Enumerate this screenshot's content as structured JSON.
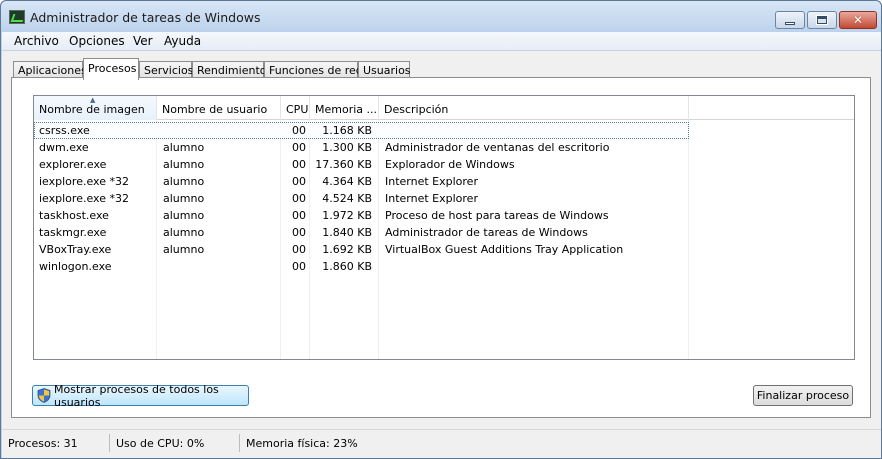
{
  "window": {
    "title": "Administrador de tareas de Windows"
  },
  "menu": [
    "Archivo",
    "Opciones",
    "Ver",
    "Ayuda"
  ],
  "tabs": [
    "Aplicaciones",
    "Procesos",
    "Servicios",
    "Rendimiento",
    "Funciones de red",
    "Usuarios"
  ],
  "active_tab": "Procesos",
  "columns": [
    "Nombre de imagen",
    "Nombre de usuario",
    "CPU",
    "Memoria ...",
    "Descripción"
  ],
  "sorted_column": "Nombre de imagen",
  "processes": [
    {
      "name": "csrss.exe",
      "user": "",
      "cpu": "00",
      "memory": "1.168 KB",
      "description": ""
    },
    {
      "name": "dwm.exe",
      "user": "alumno",
      "cpu": "00",
      "memory": "1.300 KB",
      "description": "Administrador de ventanas del escritorio"
    },
    {
      "name": "explorer.exe",
      "user": "alumno",
      "cpu": "00",
      "memory": "17.360 KB",
      "description": "Explorador de Windows"
    },
    {
      "name": "iexplore.exe *32",
      "user": "alumno",
      "cpu": "00",
      "memory": "4.364 KB",
      "description": "Internet Explorer"
    },
    {
      "name": "iexplore.exe *32",
      "user": "alumno",
      "cpu": "00",
      "memory": "4.524 KB",
      "description": "Internet Explorer"
    },
    {
      "name": "taskhost.exe",
      "user": "alumno",
      "cpu": "00",
      "memory": "1.972 KB",
      "description": "Proceso de host para tareas de Windows"
    },
    {
      "name": "taskmgr.exe",
      "user": "alumno",
      "cpu": "00",
      "memory": "1.840 KB",
      "description": "Administrador de tareas de Windows"
    },
    {
      "name": "VBoxTray.exe",
      "user": "alumno",
      "cpu": "00",
      "memory": "1.692 KB",
      "description": "VirtualBox Guest Additions Tray Application"
    },
    {
      "name": "winlogon.exe",
      "user": "",
      "cpu": "00",
      "memory": "1.860 KB",
      "description": ""
    }
  ],
  "selected_row": 0,
  "buttons": {
    "show_all": "Mostrar procesos de todos los usuarios",
    "end_process": "Finalizar proceso"
  },
  "status": {
    "processes": "Procesos: 31",
    "cpu": "Uso de CPU: 0%",
    "memory": "Memoria física: 23%"
  },
  "icons": {
    "app": "task-manager-icon",
    "shield": "uac-shield-icon",
    "minimize": "minimize-icon",
    "maximize": "maximize-icon",
    "close": "close-icon",
    "sort": "sort-ascending-icon"
  },
  "colors": {
    "frame": "#bfd3ea",
    "close_button": "#c44a33",
    "selected_button": "#bee6fd"
  }
}
